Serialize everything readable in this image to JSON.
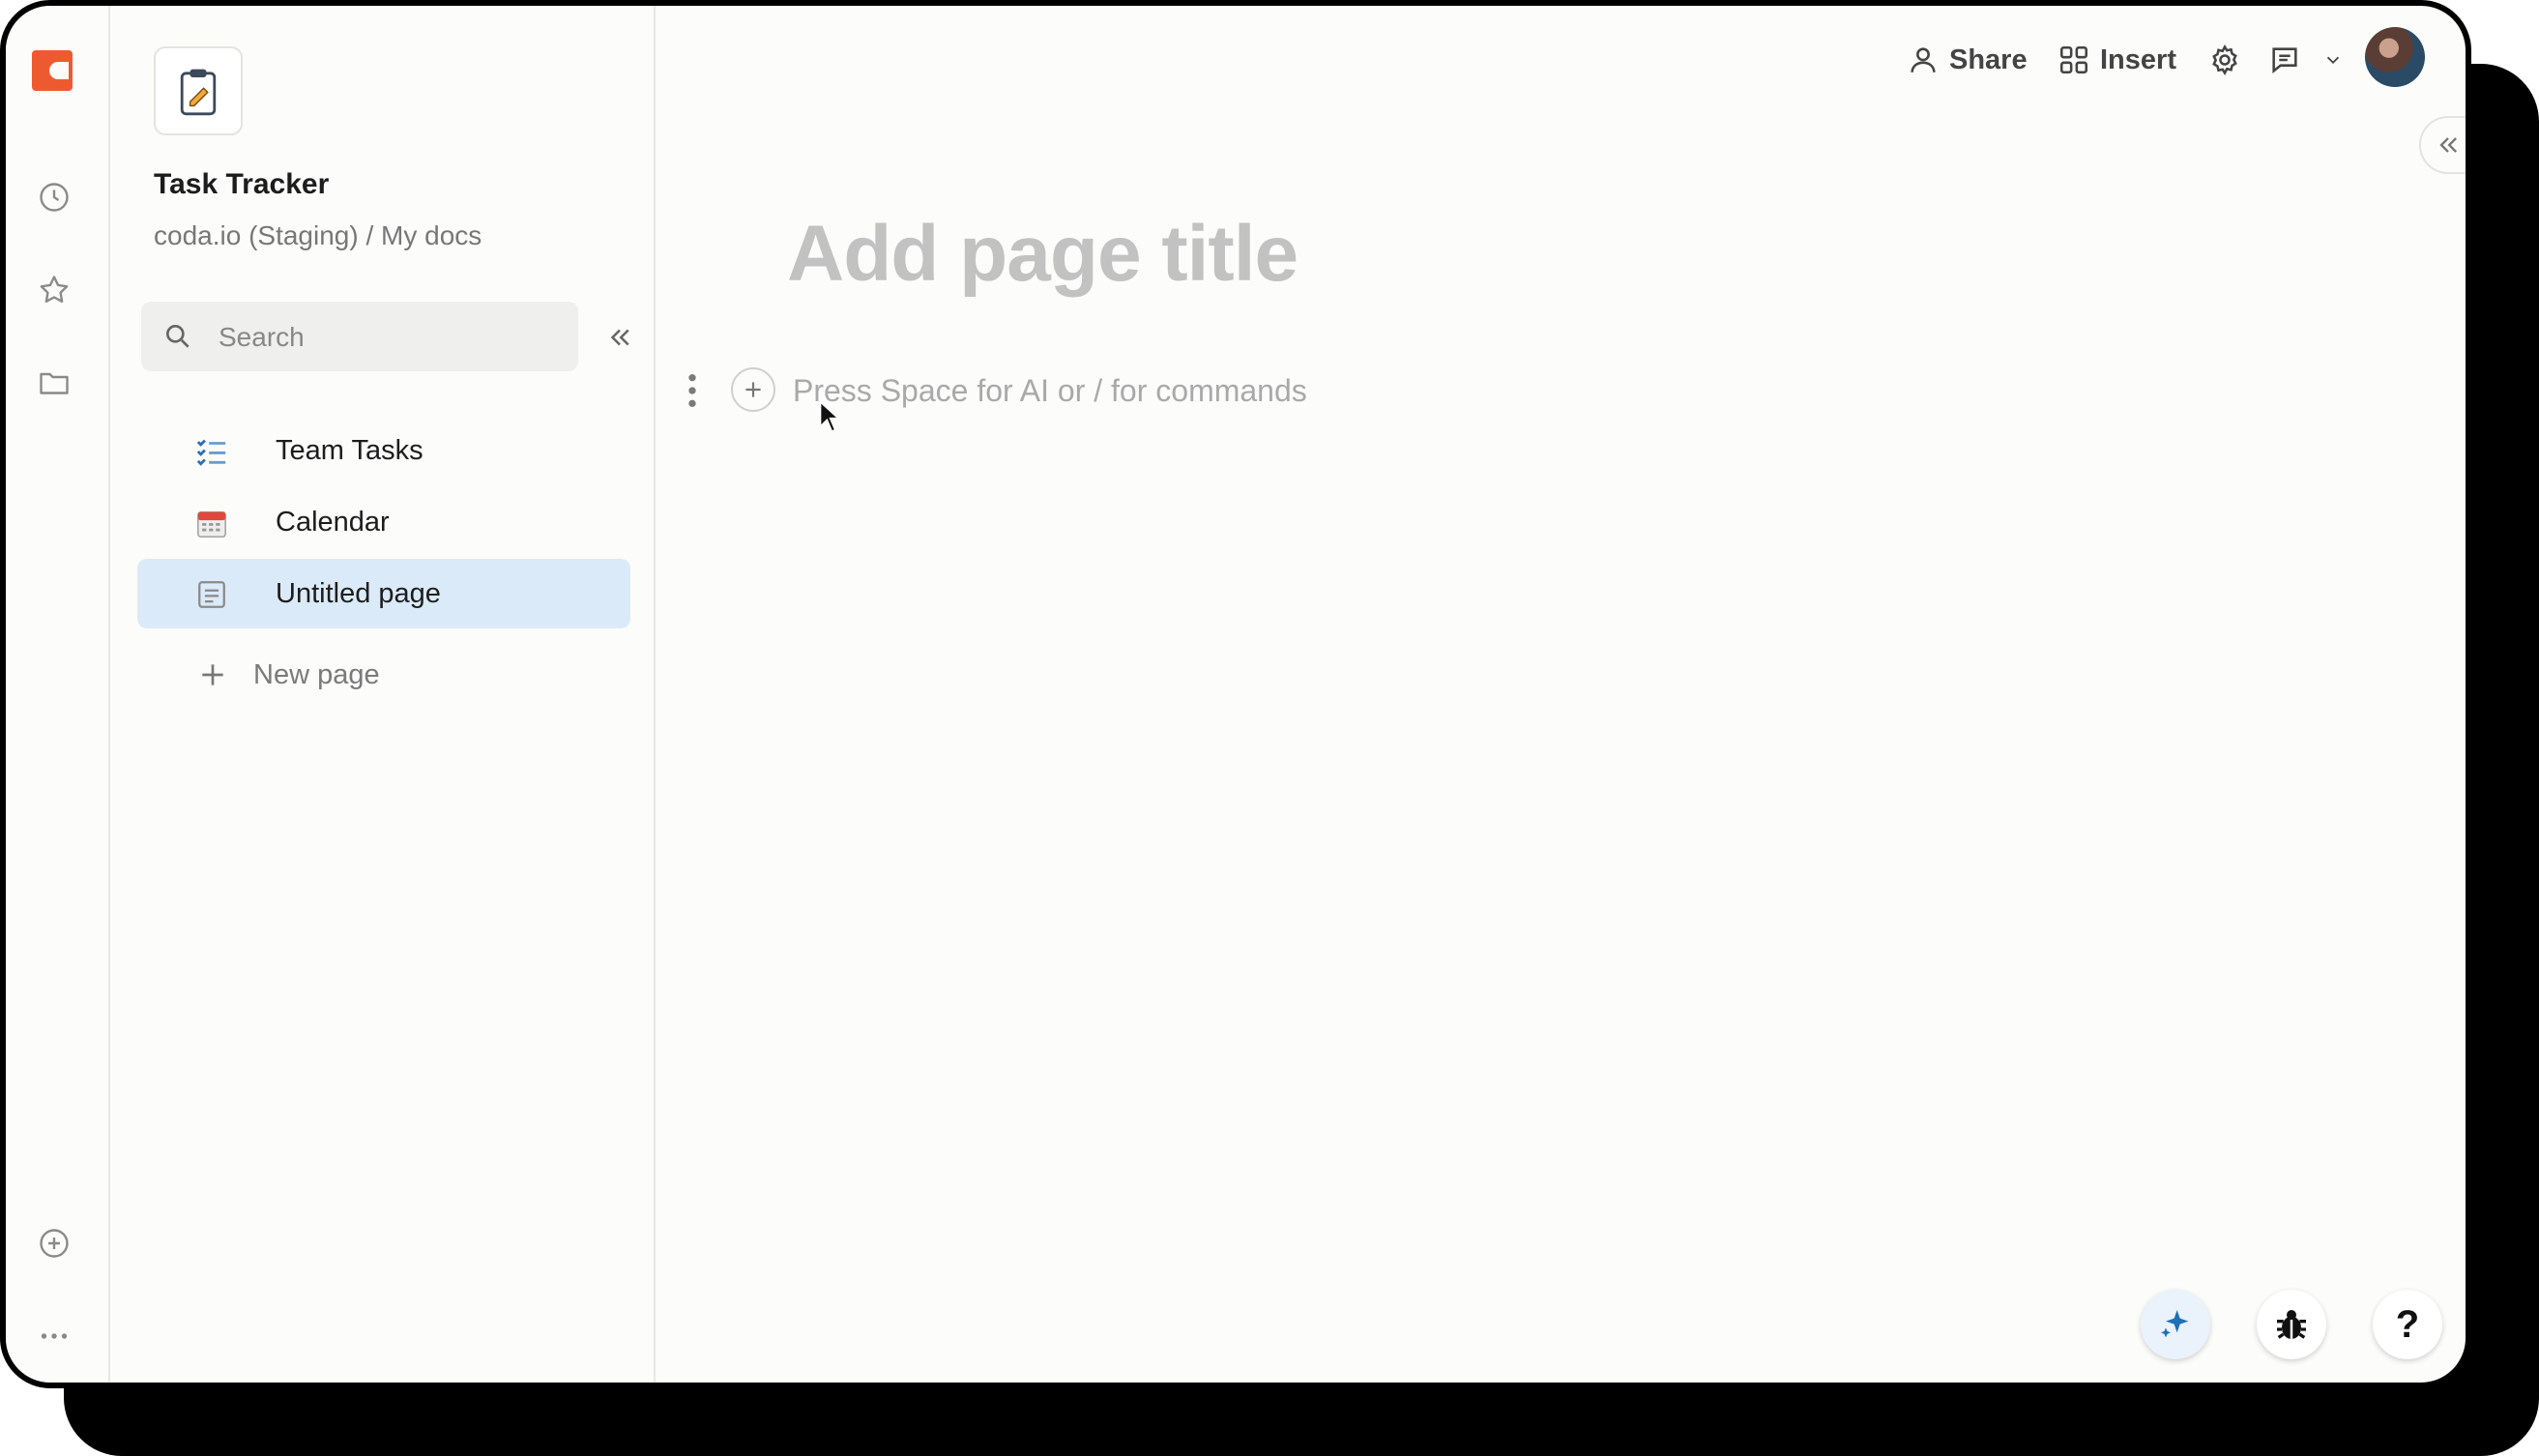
{
  "window": {
    "doc_title": "Task Tracker",
    "doc_path": "coda.io (Staging) / My docs"
  },
  "rail": {
    "icons": [
      "coda-logo-icon",
      "recent-clock-icon",
      "starred-icon",
      "folder-icon",
      "add-circle-icon",
      "more-dots-icon"
    ]
  },
  "sidebar": {
    "search_placeholder": "Search",
    "pages": [
      {
        "label": "Team Tasks",
        "icon": "checklist-icon",
        "active": false
      },
      {
        "label": "Calendar",
        "icon": "calendar-icon",
        "active": false
      },
      {
        "label": "Untitled page",
        "icon": "page-icon",
        "active": true
      }
    ],
    "new_page_label": "New page"
  },
  "toolbar": {
    "share_label": "Share",
    "insert_label": "Insert"
  },
  "canvas": {
    "title_placeholder": "Add page title",
    "block_hint": "Press Space for AI or / for commands"
  },
  "colors": {
    "brand": "#ee5a2f",
    "active_nav": "#dbeaf8",
    "ai_accent": "#1d6fb8"
  }
}
